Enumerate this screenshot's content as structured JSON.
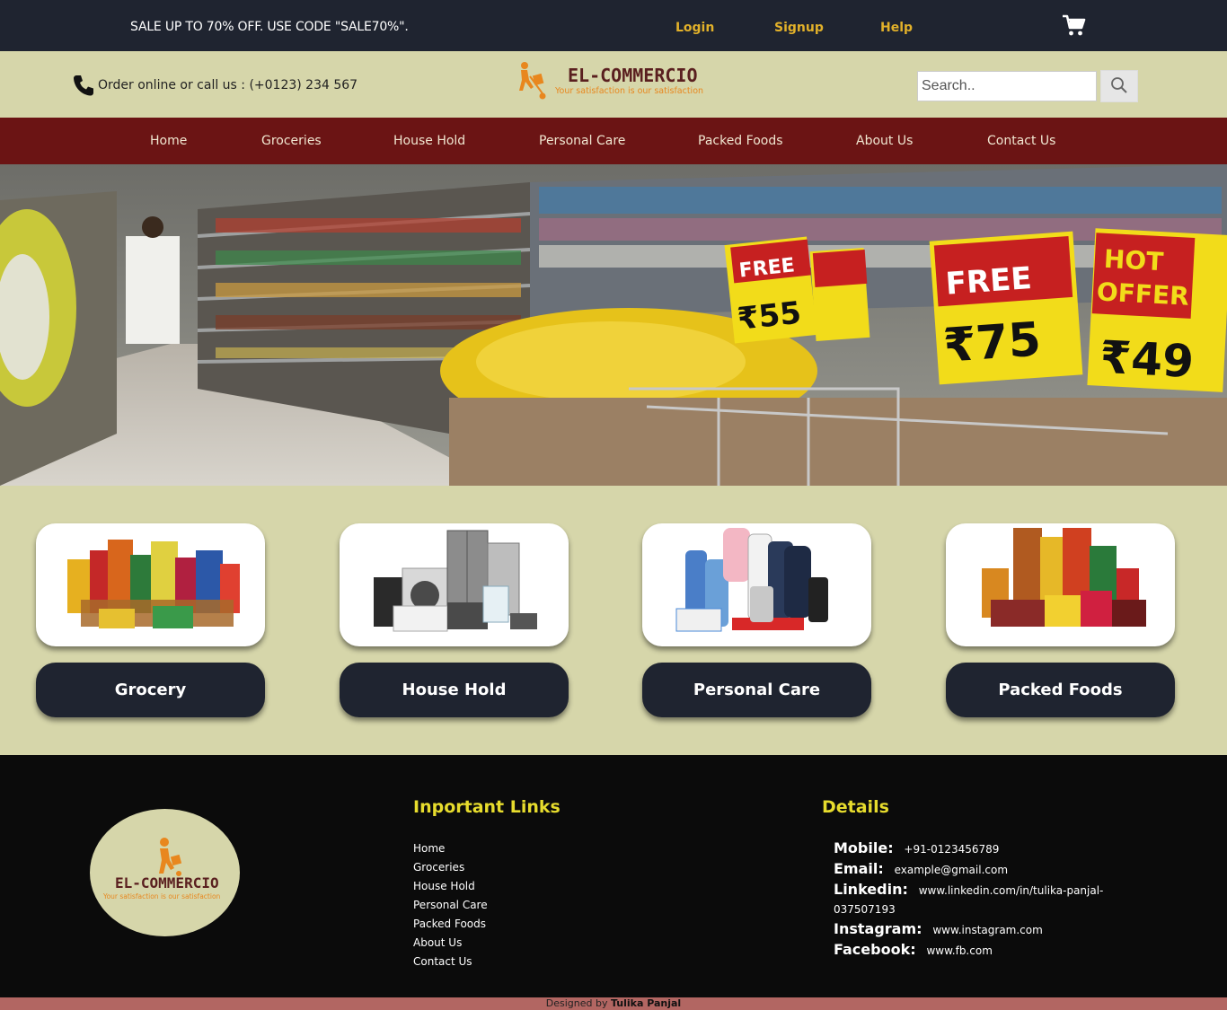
{
  "topbar": {
    "sale_text": "SALE UP TO 70% OFF. USE CODE \"SALE70%\".",
    "login": "Login",
    "signup": "Signup",
    "help": "Help",
    "cart_icon": "cart-icon",
    "link_color": "#e2b12a"
  },
  "header": {
    "order_text": "Order online or call us : (+0123) 234 567",
    "phone_icon": "phone-icon",
    "logo_title": "EL-COMMERCIO",
    "logo_tagline": "Your satisfaction is our satisfaction",
    "search_placeholder": "Search..",
    "search_icon": "search-icon"
  },
  "nav": {
    "items": [
      "Home",
      "Groceries",
      "House Hold",
      "Personal Care",
      "Packed Foods",
      "About Us",
      "Contact Us"
    ],
    "bg_color": "#6b1414"
  },
  "categories": [
    {
      "label": "Grocery",
      "image_icon": "grocery-products-image"
    },
    {
      "label": "House Hold",
      "image_icon": "household-appliances-image"
    },
    {
      "label": "Personal Care",
      "image_icon": "personal-care-products-image"
    },
    {
      "label": "Packed Foods",
      "image_icon": "packed-foods-image"
    }
  ],
  "footer": {
    "logo_title": "EL-COMMERCIO",
    "logo_tagline": "Your satisfaction is our satisfaction",
    "links_heading": "Inportant Links",
    "links": [
      "Home",
      "Groceries",
      "House Hold",
      "Personal Care",
      "Packed Foods",
      "About Us",
      "Contact Us"
    ],
    "details_heading": "Details",
    "details": {
      "mobile_label": "Mobile:",
      "mobile": "+91-0123456789",
      "email_label": "Email:",
      "email": "example@gmail.com",
      "linkedin_label": "Linkedin:",
      "linkedin": "www.linkedin.com/in/tulika-panjal-037507193",
      "instagram_label": "Instagram:",
      "instagram": "www.instagram.com",
      "facebook_label": "Facebook:",
      "facebook": "www.fb.com"
    },
    "heading_color": "#e7dc2d"
  },
  "credit": {
    "prefix": "Designed by",
    "author": "Tulika Panjal"
  }
}
